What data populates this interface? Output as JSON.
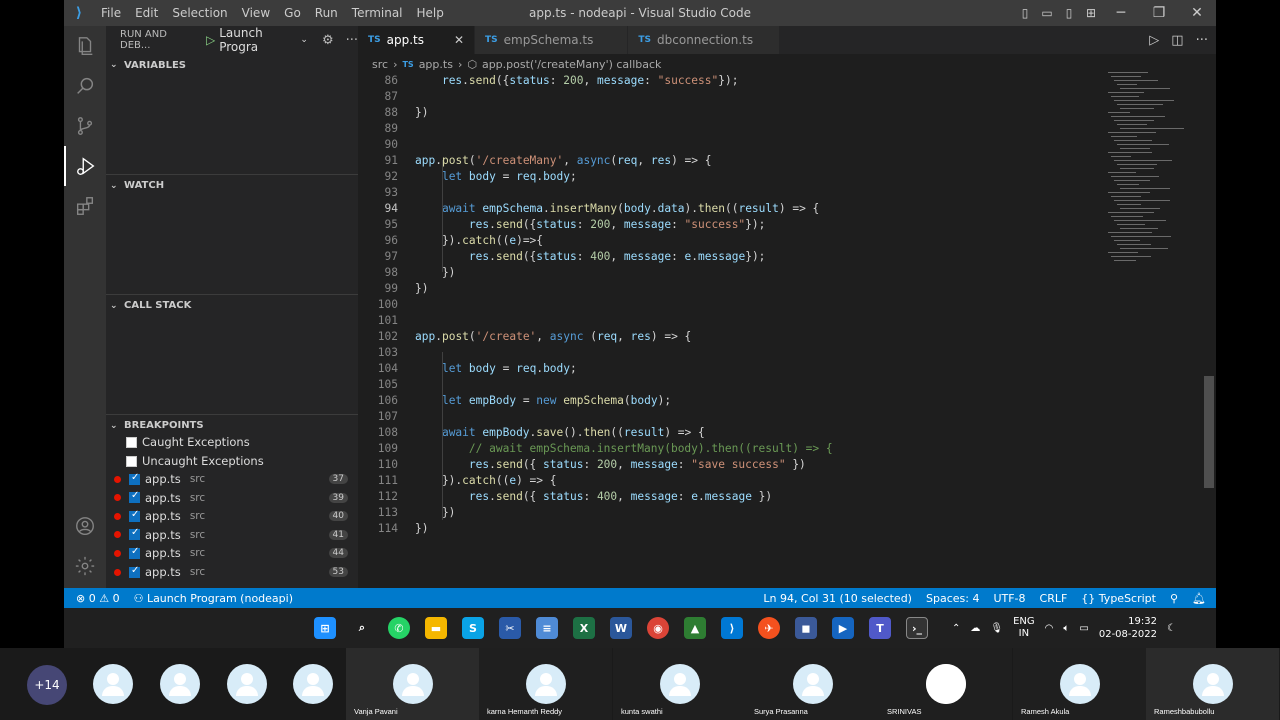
{
  "window": {
    "title": "app.ts - nodeapi - Visual Studio Code",
    "menu": [
      "File",
      "Edit",
      "Selection",
      "View",
      "Go",
      "Run",
      "Terminal",
      "Help"
    ]
  },
  "sidebar": {
    "run_label": "RUN AND DEB...",
    "config": "Launch Progra",
    "sections": {
      "variables": "VARIABLES",
      "watch": "WATCH",
      "call_stack": "CALL STACK",
      "breakpoints": "BREAKPOINTS"
    },
    "exceptions": [
      "Caught Exceptions",
      "Uncaught Exceptions"
    ],
    "breakpoints": [
      {
        "file": "app.ts",
        "dir": "src",
        "line": "37"
      },
      {
        "file": "app.ts",
        "dir": "src",
        "line": "39"
      },
      {
        "file": "app.ts",
        "dir": "src",
        "line": "40"
      },
      {
        "file": "app.ts",
        "dir": "src",
        "line": "41"
      },
      {
        "file": "app.ts",
        "dir": "src",
        "line": "44"
      },
      {
        "file": "app.ts",
        "dir": "src",
        "line": "53"
      }
    ]
  },
  "tabs": [
    {
      "label": "app.ts",
      "badge": "TS"
    },
    {
      "label": "empSchema.ts",
      "badge": "TS"
    },
    {
      "label": "dbconnection.ts",
      "badge": "TS"
    }
  ],
  "breadcrumb": {
    "folder": "src",
    "file": "app.ts",
    "symbol": "app.post('/createMany') callback"
  },
  "code": [
    {
      "no": "86",
      "indent": 1,
      "text": "res.send({status: 200, message: \"success\"});"
    },
    {
      "no": "87",
      "indent": 0,
      "text": ""
    },
    {
      "no": "88",
      "indent": 0,
      "text": "})"
    },
    {
      "no": "89",
      "indent": 0,
      "text": ""
    },
    {
      "no": "90",
      "indent": 0,
      "text": ""
    },
    {
      "no": "91",
      "indent": 0,
      "text": "app.post('/createMany', async(req, res) => {"
    },
    {
      "no": "92",
      "indent": 1,
      "text": "let body = req.body;"
    },
    {
      "no": "93",
      "indent": 0,
      "text": ""
    },
    {
      "no": "94",
      "indent": 1,
      "text": "await empSchema.insertMany(body.data).then((result) => {"
    },
    {
      "no": "95",
      "indent": 2,
      "text": "res.send({status: 200, message: \"success\"});"
    },
    {
      "no": "96",
      "indent": 1,
      "text": "}).catch((e)=>{"
    },
    {
      "no": "97",
      "indent": 2,
      "text": "res.send({status: 400, message: e.message});"
    },
    {
      "no": "98",
      "indent": 1,
      "text": "})"
    },
    {
      "no": "99",
      "indent": 0,
      "text": "})"
    },
    {
      "no": "100",
      "indent": 0,
      "text": ""
    },
    {
      "no": "101",
      "indent": 0,
      "text": ""
    },
    {
      "no": "102",
      "indent": 0,
      "text": "app.post('/create', async (req, res) => {"
    },
    {
      "no": "103",
      "indent": 0,
      "text": ""
    },
    {
      "no": "104",
      "indent": 1,
      "text": "let body = req.body;"
    },
    {
      "no": "105",
      "indent": 0,
      "text": ""
    },
    {
      "no": "106",
      "indent": 1,
      "text": "let empBody = new empSchema(body);"
    },
    {
      "no": "107",
      "indent": 0,
      "text": ""
    },
    {
      "no": "108",
      "indent": 1,
      "text": "await empBody.save().then((result) => {"
    },
    {
      "no": "109",
      "indent": 2,
      "text": "// await empSchema.insertMany(body).then((result) => {"
    },
    {
      "no": "110",
      "indent": 2,
      "text": "res.send({ status: 200, message: \"save success\" })"
    },
    {
      "no": "111",
      "indent": 1,
      "text": "}).catch((e) => {"
    },
    {
      "no": "112",
      "indent": 2,
      "text": "res.send({ status: 400, message: e.message })"
    },
    {
      "no": "113",
      "indent": 1,
      "text": "})"
    },
    {
      "no": "114",
      "indent": 0,
      "text": "})"
    }
  ],
  "current_line": "94",
  "status": {
    "problems": "⊗ 0 ⚠ 0",
    "launch": "Launch Program (nodeapi)",
    "position": "Ln 94, Col 31 (10 selected)",
    "spaces": "Spaces: 4",
    "encoding": "UTF-8",
    "eol": "CRLF",
    "language": "TypeScript"
  },
  "tray": {
    "lang1": "ENG",
    "lang2": "IN",
    "time": "19:32",
    "date": "02-08-2022"
  },
  "meeting": {
    "more": "+14",
    "participants": [
      "Vanja Pavani",
      "karna Hemanth Reddy",
      "kunta swathi",
      "Surya Prasanna",
      "SRINIVAS",
      "Ramesh Akula",
      "Rameshbabubollu"
    ]
  },
  "colors": {
    "accent": "#007acc",
    "keyword": "#569cd6",
    "string": "#ce9178",
    "function": "#dcdcaa",
    "variable": "#9cdcfe",
    "comment": "#6a9955",
    "number": "#b5cea8"
  }
}
